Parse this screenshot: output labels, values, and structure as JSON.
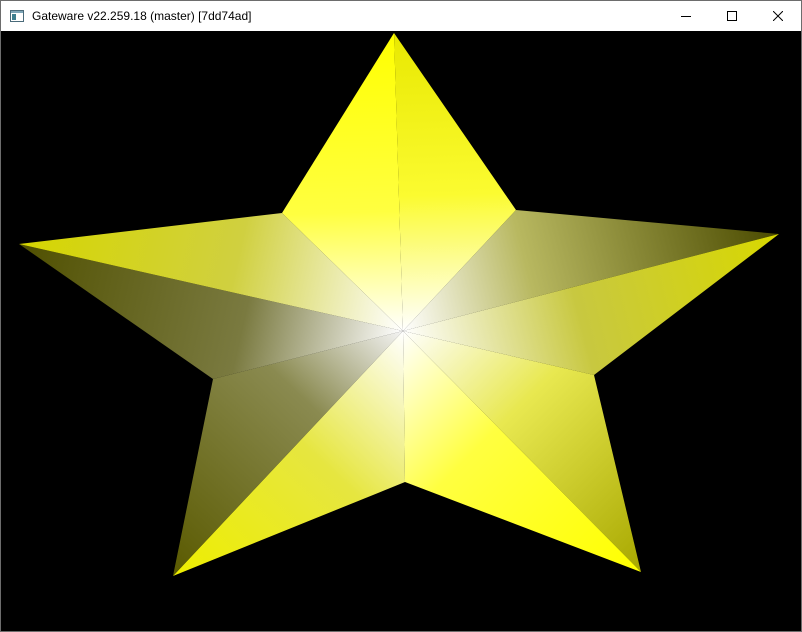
{
  "window": {
    "title": "Gateware v22.259.18 (master) [7dd74ad]",
    "icon": "app-window-icon"
  },
  "controls": {
    "minimize_icon": "minimize-icon",
    "maximize_icon": "maximize-icon",
    "close_icon": "close-icon"
  },
  "scene": {
    "background_color": "#000000",
    "star_color": "#ffff00",
    "highlight_color": "#ffffff",
    "shadow_color": "#3a3a00"
  }
}
